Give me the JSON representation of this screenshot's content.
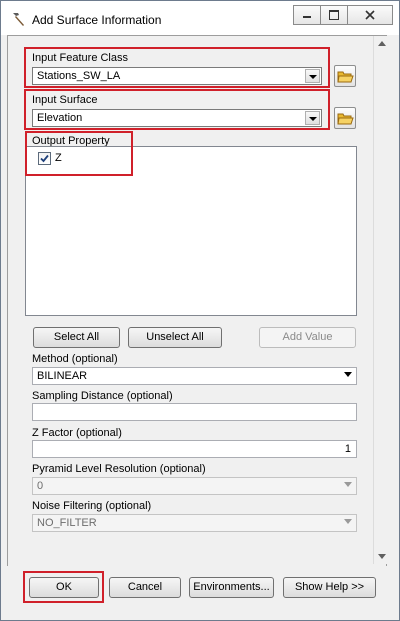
{
  "window": {
    "title": "Add Surface Information",
    "title_icon": "hammer-icon",
    "controls": [
      "minimize-icon",
      "maximize-icon",
      "close-icon"
    ]
  },
  "form": {
    "input_feature_class": {
      "label": "Input Feature Class",
      "value": "Stations_SW_LA"
    },
    "input_surface": {
      "label": "Input Surface",
      "value": "Elevation"
    },
    "output_property": {
      "label": "Output Property",
      "items": [
        {
          "label": "Z",
          "checked": true
        }
      ]
    },
    "select_all_label": "Select All",
    "unselect_all_label": "Unselect All",
    "add_value_label": "Add Value",
    "method": {
      "label": "Method (optional)",
      "value": "BILINEAR"
    },
    "sampling_distance": {
      "label": "Sampling Distance (optional)",
      "value": ""
    },
    "z_factor": {
      "label": "Z Factor (optional)",
      "value": "1"
    },
    "pyramid_level": {
      "label": "Pyramid Level Resolution (optional)",
      "value": "0"
    },
    "noise_filtering": {
      "label": "Noise Filtering (optional)",
      "value": "NO_FILTER"
    }
  },
  "buttons": {
    "ok": "OK",
    "cancel": "Cancel",
    "environments": "Environments...",
    "show_help": "Show Help >>"
  },
  "colors": {
    "highlight": "#d0202a"
  }
}
